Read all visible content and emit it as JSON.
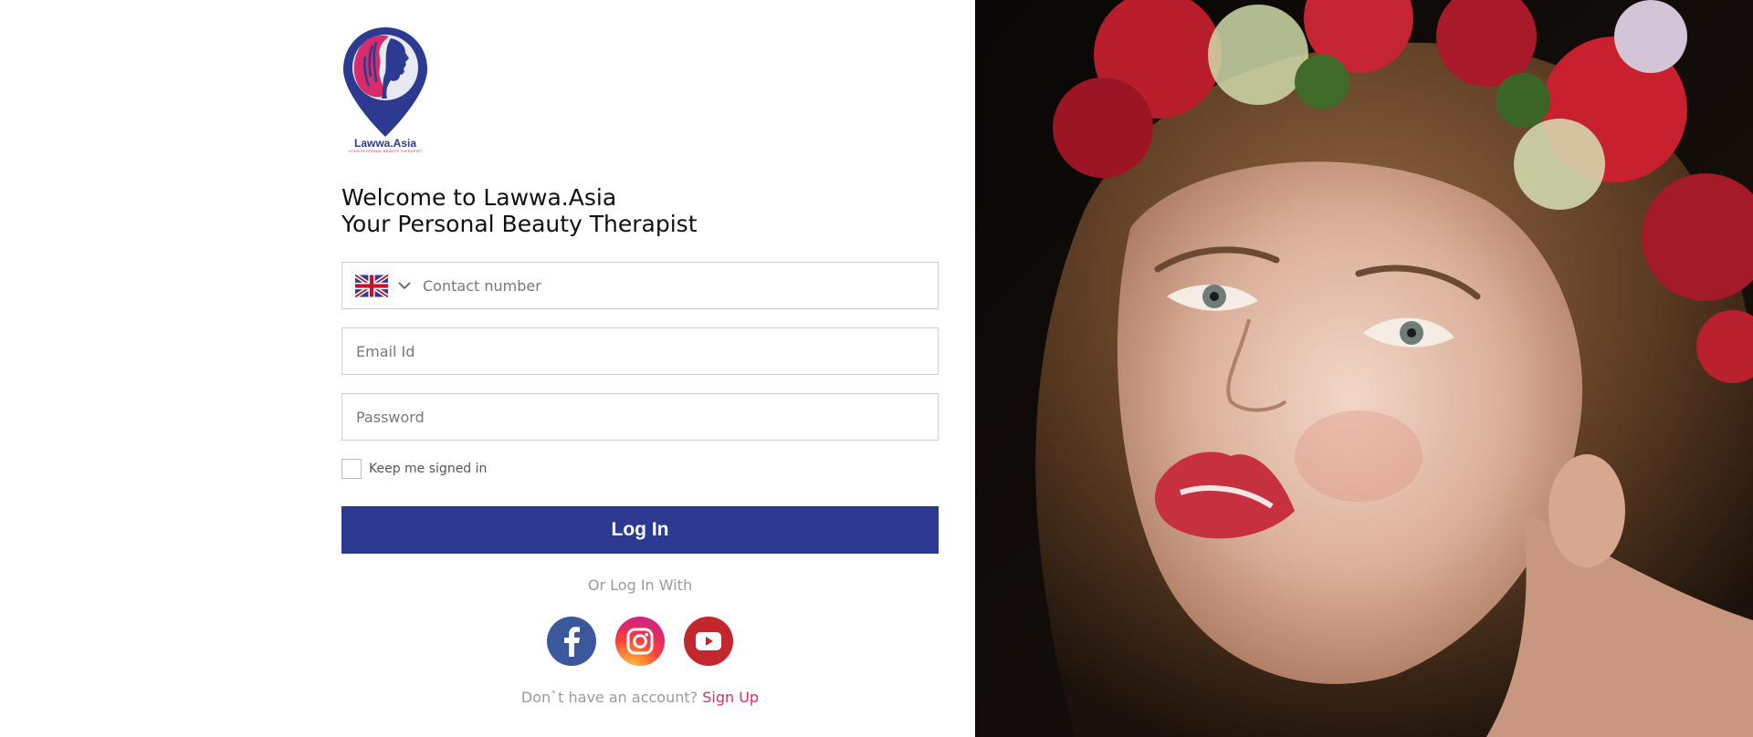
{
  "brand": {
    "name": "Lawwa.Asia",
    "tagline": "YOUR PERSONAL BEAUTY THERAPIST",
    "colors": {
      "primary": "#2c3a91",
      "accent": "#d82c6a"
    }
  },
  "heading": {
    "line1": "Welcome to Lawwa.Asia",
    "line2": "Your Personal Beauty Therapist"
  },
  "form": {
    "phone": {
      "country_flag": "uk-flag-icon",
      "placeholder": "Contact number",
      "value": ""
    },
    "email": {
      "placeholder": "Email Id",
      "value": ""
    },
    "password": {
      "placeholder": "Password",
      "value": ""
    },
    "remember": {
      "label": "Keep me signed in",
      "checked": false
    },
    "login_label": "Log In"
  },
  "social": {
    "heading": "Or Log In With",
    "items": [
      {
        "name": "facebook",
        "icon": "facebook-icon",
        "color": "#3a589b"
      },
      {
        "name": "instagram",
        "icon": "instagram-icon",
        "color": "#e02a63"
      },
      {
        "name": "youtube",
        "icon": "youtube-icon",
        "color": "#c4262d"
      }
    ]
  },
  "signup": {
    "prompt": "Don`t have an account?",
    "link": "Sign Up"
  },
  "hero": {
    "image": "model-portrait-with-flower-crown"
  }
}
